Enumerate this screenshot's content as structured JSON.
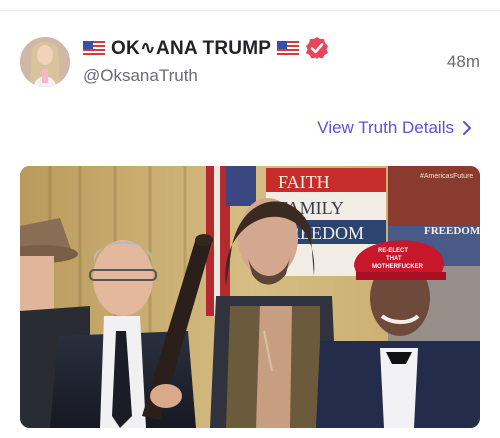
{
  "post": {
    "display_name": "OK∿ANA TRUMP",
    "handle": "@OksanaTruth",
    "timestamp": "48m",
    "details_link_label": "View Truth Details",
    "flag_icon": "us-flag-icon",
    "verified_icon": "verified-badge-icon",
    "chevron_icon": "chevron-right-icon"
  },
  "image": {
    "sign_words": [
      "FAITH",
      "FAMILY",
      "FREEDOM"
    ],
    "banner_word": "FREEDOM",
    "banner_corner": "#AmericasFuture",
    "cap_text": [
      "RE-ELECT",
      "THAT",
      "MOTHERFUCKER"
    ]
  },
  "colors": {
    "accent": "#5b52d6",
    "verified": "#e8465a",
    "cap_red": "#c8162b"
  }
}
